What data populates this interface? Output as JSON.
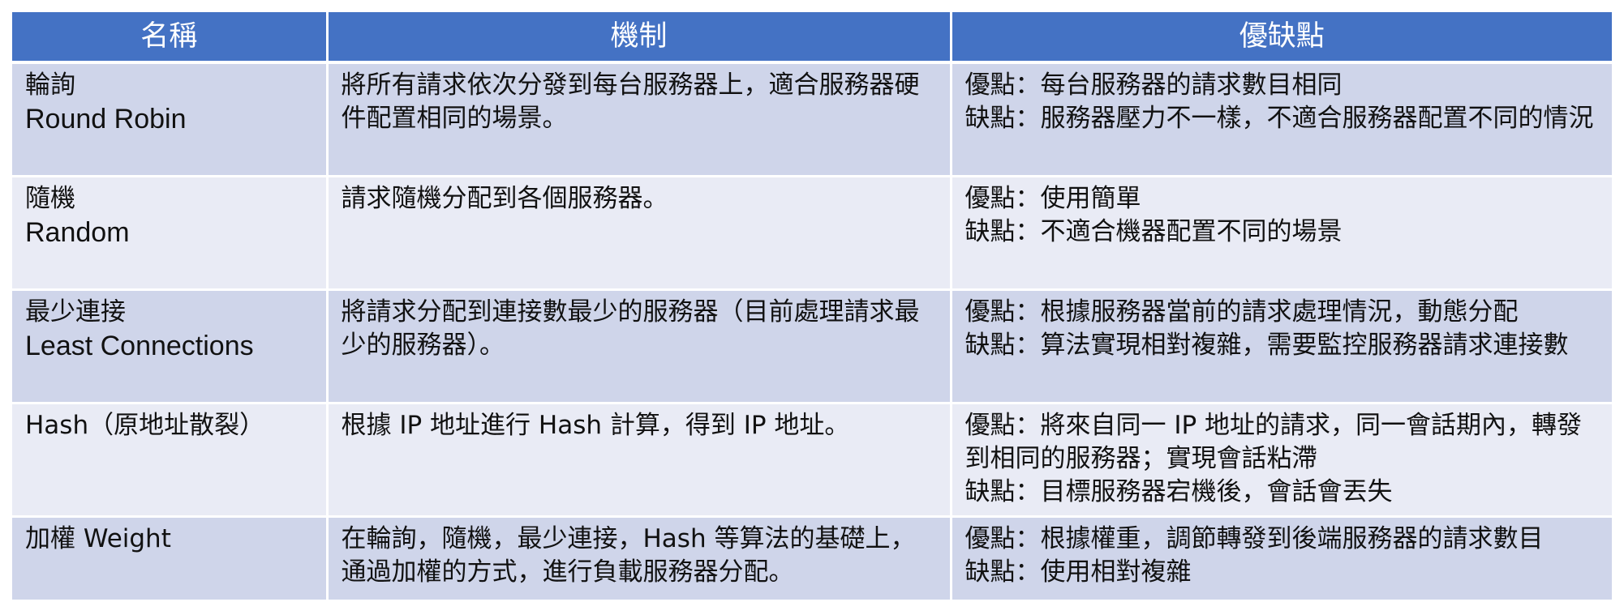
{
  "table": {
    "headers": [
      "名稱",
      "機制",
      "優缺點"
    ],
    "rows": [
      {
        "name_zh": "輪詢",
        "name_en": "Round Robin",
        "mechanism": "將所有請求依次分發到每台服務器上，適合服務器硬件配置相同的場景。",
        "pros_cons": [
          "優點：每台服務器的請求數目相同",
          "缺點：服務器壓力不一樣，不適合服務器配置不同的情況"
        ]
      },
      {
        "name_zh": "隨機",
        "name_en": "Random",
        "mechanism": "請求隨機分配到各個服務器。",
        "pros_cons": [
          "優點：使用簡單",
          "缺點：不適合機器配置不同的場景"
        ]
      },
      {
        "name_zh": "最少連接",
        "name_en": "Least Connections",
        "mechanism": "將請求分配到連接數最少的服務器（目前處理請求最少的服務器）。",
        "pros_cons": [
          "優點：根據服務器當前的請求處理情況，動態分配",
          "缺點：算法實現相對複雜，需要監控服務器請求連接數"
        ]
      },
      {
        "name_zh": "Hash（原地址散裂）",
        "name_en": "",
        "mechanism": "根據 IP 地址進行 Hash 計算，得到 IP 地址。",
        "pros_cons": [
          "優點：將來自同一 IP 地址的請求，同一會話期內，轉發到相同的服務器；實現會話粘滯",
          "缺點：目標服務器宕機後，會話會丟失"
        ]
      },
      {
        "name_zh": "加權 Weight",
        "name_en": "",
        "mechanism": "在輪詢，隨機，最少連接，Hash 等算法的基礎上，通過加權的方式，進行負載服務器分配。",
        "pros_cons": [
          "優點：根據權重，調節轉發到後端服務器的請求數目",
          "缺點：使用相對複雜"
        ]
      }
    ]
  },
  "colors": {
    "header_bg": "#4472c4",
    "row_dark": "#cfd5ea",
    "row_light": "#e9ebf5"
  }
}
